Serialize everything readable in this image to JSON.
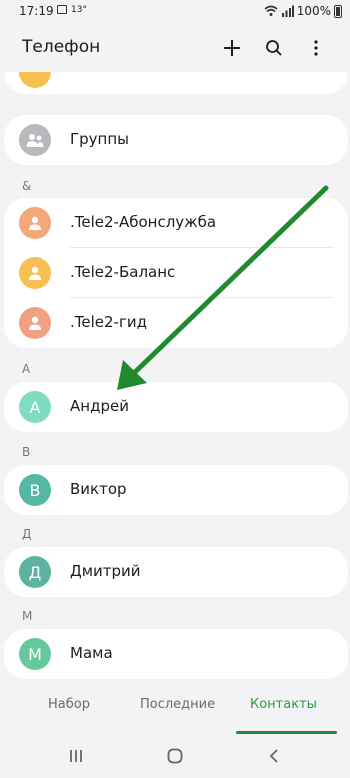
{
  "status_bar": {
    "time": "17:19",
    "temperature": "13°",
    "battery": "100%"
  },
  "app_bar": {
    "title": "Телефон"
  },
  "groups_row": {
    "label": "Группы"
  },
  "sections": [
    {
      "letter": "&",
      "contacts": [
        {
          "name": ".Tele2-Абонслужба",
          "color": "#f5a877"
        },
        {
          "name": ".Tele2-Баланс",
          "color": "#f8c053"
        },
        {
          "name": ".Tele2-гид",
          "color": "#f2a085"
        }
      ]
    },
    {
      "letter": "А",
      "contacts": [
        {
          "name": "Андрей",
          "initial": "А",
          "color": "#7fdcc2"
        }
      ]
    },
    {
      "letter": "В",
      "contacts": [
        {
          "name": "Виктор",
          "initial": "В",
          "color": "#56b7a2"
        }
      ]
    },
    {
      "letter": "Д",
      "contacts": [
        {
          "name": "Дмитрий",
          "initial": "Д",
          "color": "#5db3a0"
        }
      ]
    },
    {
      "letter": "М",
      "contacts": [
        {
          "name": "Мама",
          "initial": "М",
          "color": "#65c99b"
        }
      ]
    }
  ],
  "tabs": [
    "Набор",
    "Последние",
    "Контакты"
  ],
  "active_tab": "Контакты",
  "colors": {
    "accent": "#2b9a44",
    "arrow": "#1f8a2e",
    "background": "#f3f3f5"
  }
}
